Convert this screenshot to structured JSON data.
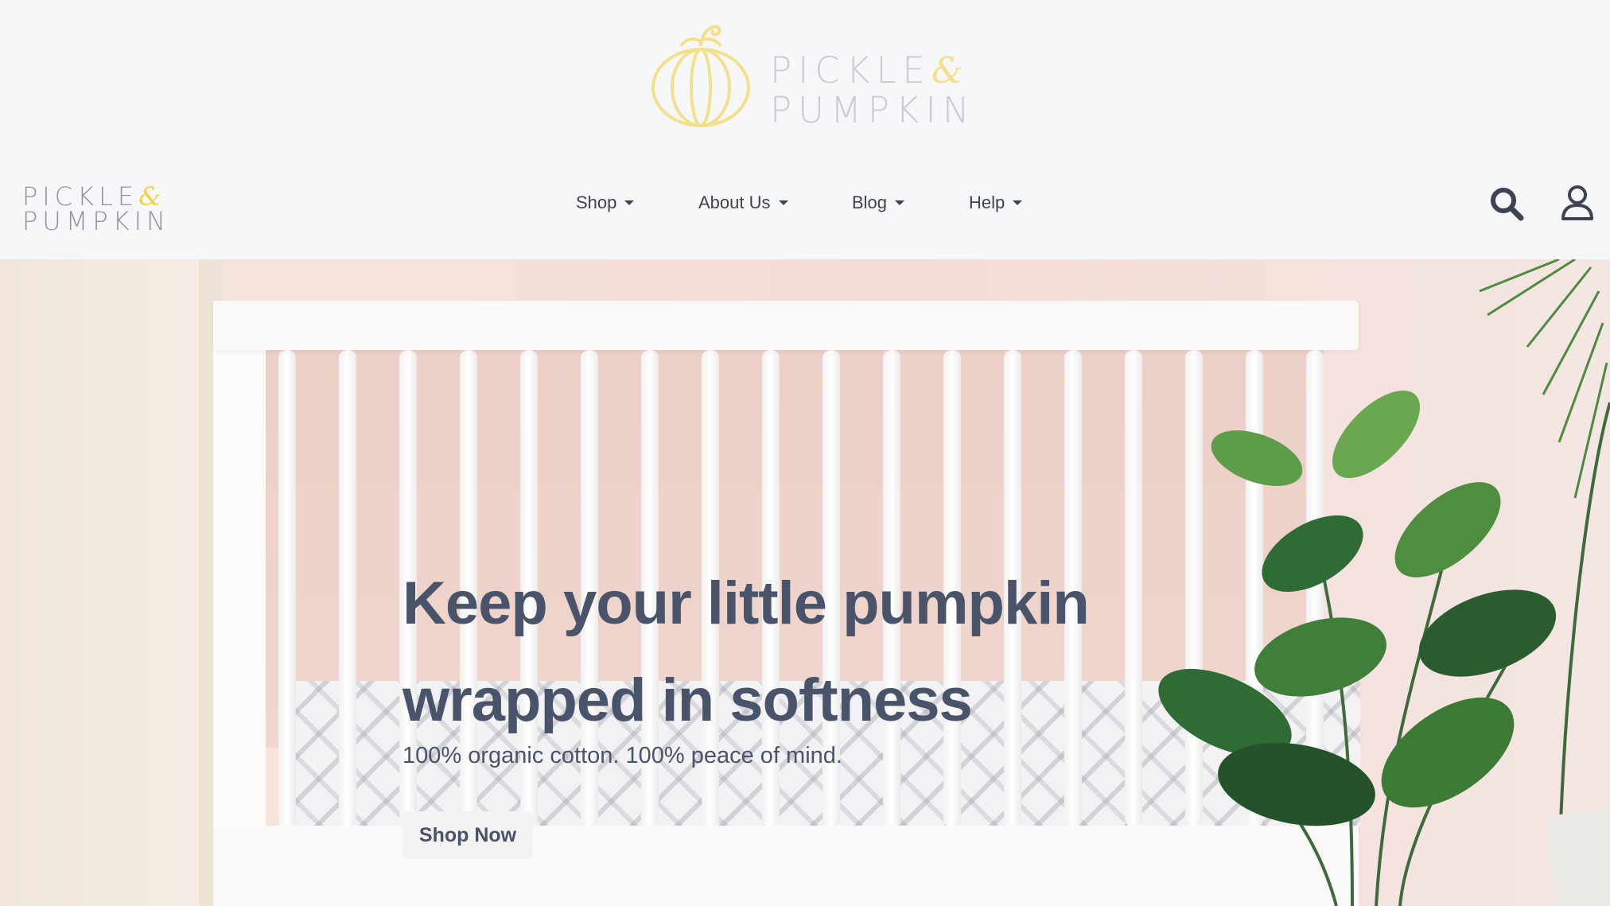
{
  "brand": {
    "name_line1": "PICKLE",
    "amp": "&",
    "name_line2": "PUMPKIN",
    "logo_color": "#f3e08a"
  },
  "nav": {
    "items": [
      {
        "label": "Shop"
      },
      {
        "label": "About Us"
      },
      {
        "label": "Blog"
      },
      {
        "label": "Help"
      }
    ],
    "icons": [
      "search-icon",
      "user-icon"
    ]
  },
  "hero": {
    "title_line1": "Keep your little pumpkin",
    "title_line2": "wrapped in softness",
    "subtitle": "100% organic cotton. 100% peace of mind.",
    "cta_label": "Shop Now"
  },
  "colors": {
    "text_dark": "#49546a",
    "page_bg": "#f6f7f9"
  }
}
